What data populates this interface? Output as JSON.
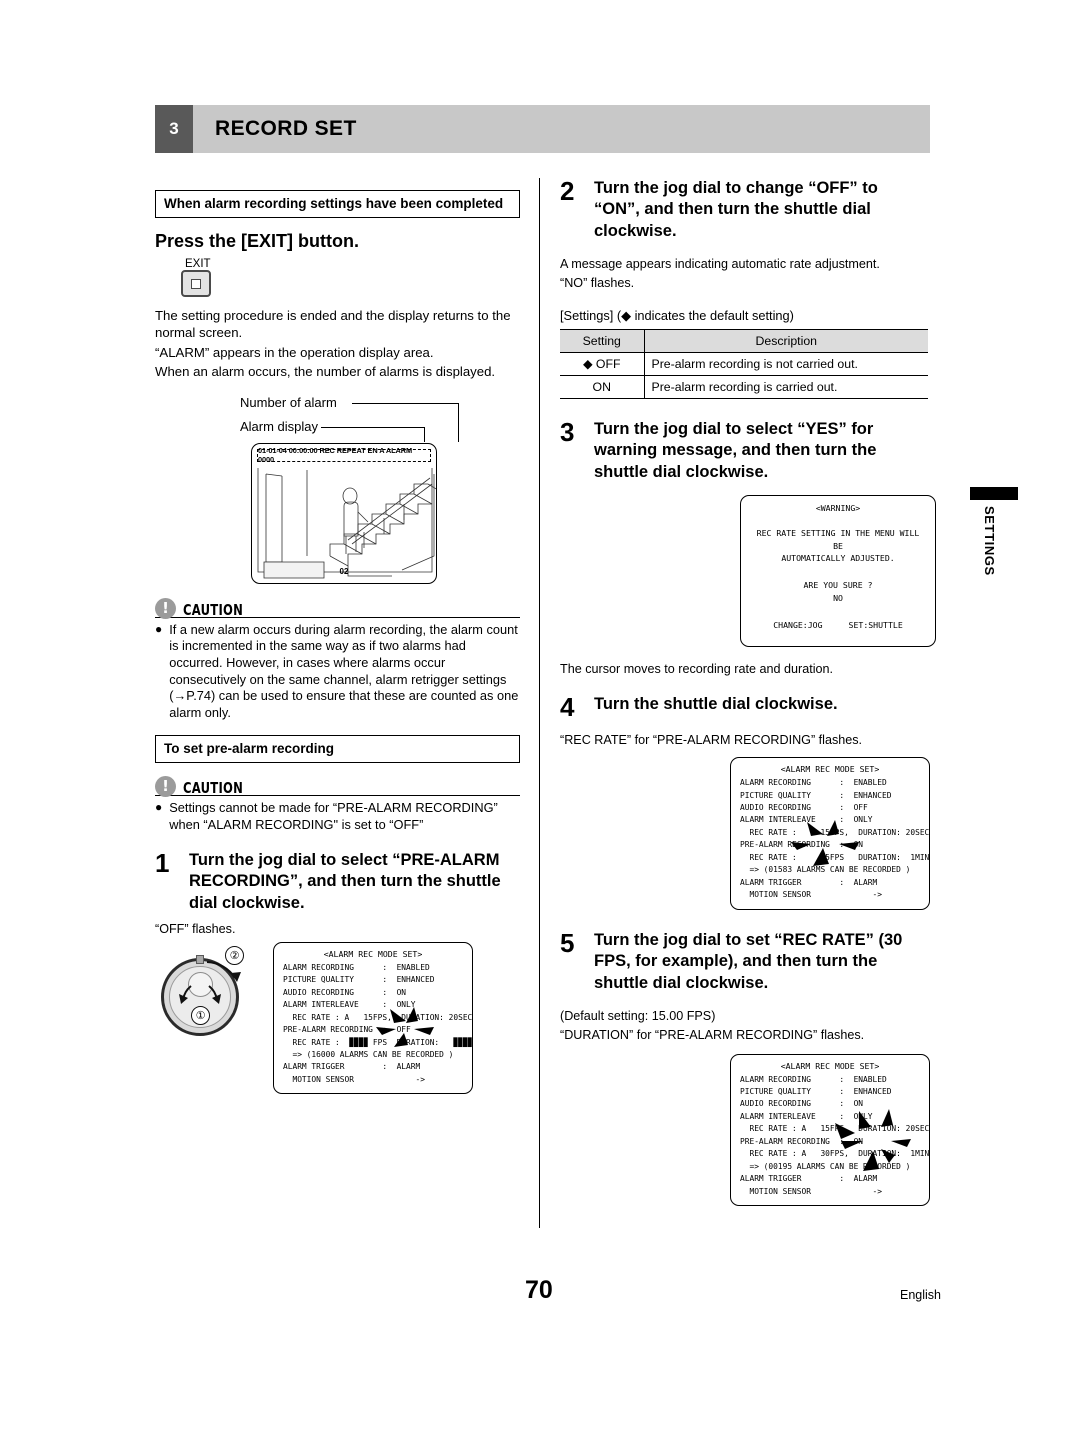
{
  "header": {
    "number": "3",
    "title": "RECORD SET"
  },
  "left": {
    "section_title": "When alarm recording settings have been completed",
    "heading": "Press the [EXIT] button.",
    "exit_key_label": "EXIT",
    "paragraphs": [
      "The setting procedure is ended and the display returns to the normal screen.",
      "“ALARM” appears in the operation display area.",
      "When an alarm occurs, the number of alarms is displayed."
    ],
    "callout_number_of_alarm": "Number of alarm",
    "callout_alarm_display": "Alarm display",
    "monitor": {
      "osd_line": "01-01-04 00:00:00 REC REPEAT EN A ALARM 0000",
      "camera_number": "02"
    },
    "caution1": {
      "title": "CAUTION",
      "icon": "exclamation-icon",
      "bullet": "●",
      "text": "If a new alarm occurs during alarm recording, the alarm count is incremented in the same way as if two alarms had occurred. However, in cases where alarms occur consecutively on the same channel, alarm retrigger settings (→P.74) can be used to ensure that these are counted as one alarm only."
    },
    "section_title2": "To set pre-alarm recording",
    "caution2": {
      "title": "CAUTION",
      "icon": "exclamation-icon",
      "bullet": "●",
      "text": "Settings cannot be made for “PRE-ALARM RECORDING” when “ALARM RECORDING\" is set to “OFF”"
    },
    "step1": {
      "number": "1",
      "text": "Turn the jog dial to select “PRE-ALARM RECORDING”, and then turn the shuttle dial clockwise.",
      "note": "“OFF” flashes."
    },
    "jog": {
      "badge1": "①",
      "badge2": "②"
    },
    "osd1": {
      "title": "<ALARM REC MODE SET>",
      "rows": [
        "ALARM RECORDING      :  ENABLED",
        "PICTURE QUALITY      :  ENHANCED",
        "AUDIO RECORDING      :  ON",
        "ALARM INTERLEAVE     :  ONLY",
        "  REC RATE : A   15FPS,  DURATION: 20SEC",
        "PRE-ALARM RECORDING  :  OFF",
        "  REC RATE :  ▉▉▉▉ FPS  DURATION:   ▉▉▉▉",
        "  => (16000 ALARMS CAN BE RECORDED )",
        "ALARM TRIGGER        :  ALARM",
        "  MOTION SENSOR             ->"
      ]
    }
  },
  "right": {
    "step2": {
      "number": "2",
      "text": "Turn the jog dial to change “OFF” to “ON”, and then turn the shuttle dial clockwise.",
      "note1": "A message appears indicating automatic rate adjustment.",
      "note2": "“NO” flashes."
    },
    "settings_lead": "[Settings] (◆ indicates the default setting)",
    "settings_table": {
      "headers": [
        "Setting",
        "Description"
      ],
      "rows": [
        [
          "◆ OFF",
          "Pre-alarm recording is not carried out."
        ],
        [
          "ON",
          "Pre-alarm recording is carried out."
        ]
      ]
    },
    "step3": {
      "number": "3",
      "text": "Turn the jog dial to select “YES” for warning message, and then turn the shuttle dial clockwise.",
      "note": "The cursor moves to recording rate and duration."
    },
    "warning_osd": {
      "title": "<WARNING>",
      "line1": "REC RATE SETTING IN THE MENU WILL BE",
      "line2": "AUTOMATICALLY ADJUSTED.",
      "line3": "ARE YOU SURE ?",
      "line4": "NO",
      "foot_left": "CHANGE:JOG",
      "foot_right": "SET:SHUTTLE"
    },
    "step4": {
      "number": "4",
      "text": "Turn the shuttle dial clockwise.",
      "note": "“REC RATE” for “PRE-ALARM RECORDING” flashes."
    },
    "osd2": {
      "title": "<ALARM REC MODE SET>",
      "rows": [
        "ALARM RECORDING      :  ENABLED",
        "PICTURE QUALITY      :  ENHANCED",
        "AUDIO RECORDING      :  OFF",
        "ALARM INTERLEAVE     :  ONLY",
        "  REC RATE :     15FPS,  DURATION: 20SEC",
        "PRE-ALARM RECORDING  :  ON",
        "  REC RATE :     15FPS   DURATION:  1MIN",
        "  => (01583 ALARMS CAN BE RECORDED )",
        "ALARM TRIGGER        :  ALARM",
        "  MOTION SENSOR             ->"
      ]
    },
    "step5": {
      "number": "5",
      "text": "Turn the jog dial to set “REC RATE” (30 FPS, for example), and then turn the shuttle dial clockwise.",
      "note1": "(Default setting: 15.00 FPS)",
      "note2": "“DURATION” for “PRE-ALARM RECORDING” flashes."
    },
    "osd3": {
      "title": "<ALARM REC MODE SET>",
      "rows": [
        "ALARM RECORDING      :  ENABLED",
        "PICTURE QUALITY      :  ENHANCED",
        "AUDIO RECORDING      :  ON",
        "ALARM INTERLEAVE     :  ONLY",
        "  REC RATE : A   15FPS,  DURATION: 20SEC",
        "PRE-ALARM RECORDING  :  ON",
        "  REC RATE : A   30FPS,  DURATION:  1MIN",
        "  => (00195 ALARMS CAN BE RECORDED )",
        "ALARM TRIGGER        :  ALARM",
        "  MOTION SENSOR             ->"
      ]
    }
  },
  "side_tab": {
    "label": "SETTINGS"
  },
  "footer": {
    "page_number": "70",
    "language": "English"
  }
}
